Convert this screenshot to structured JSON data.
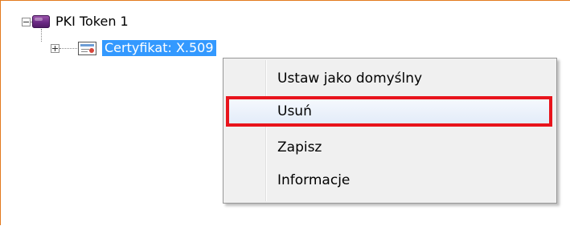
{
  "tree": {
    "root": {
      "label": "PKI Token 1",
      "icon": "token-icon",
      "expanded": true
    },
    "child": {
      "label": "Certyfikat: X.509",
      "icon": "certificate-icon",
      "expanded": false,
      "selected": true
    }
  },
  "context_menu": {
    "items": [
      {
        "label": "Ustaw jako domyślny"
      },
      {
        "label": "Usuń",
        "highlighted": true
      },
      {
        "label": "Zapisz"
      },
      {
        "label": "Informacje"
      }
    ],
    "highlight_color": "#e8141c"
  },
  "colors": {
    "frame_border": "#e37a1e",
    "selection": "#3399ff",
    "menu_background": "#f0f0f0"
  }
}
